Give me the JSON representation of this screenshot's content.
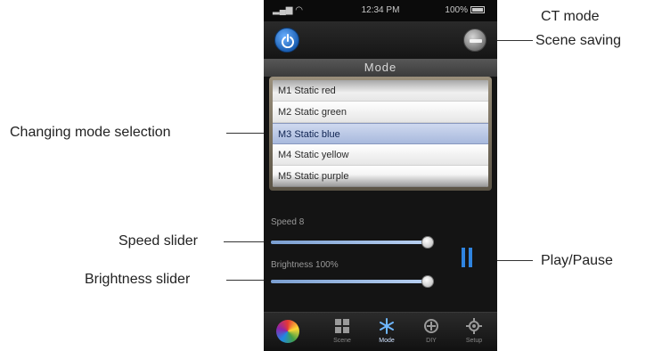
{
  "callouts": {
    "ct_mode": "CT mode",
    "scene_saving": "Scene saving",
    "changing_mode": "Changing mode selection",
    "speed_slider": "Speed slider",
    "play_pause": "Play/Pause",
    "brightness_slider": "Brightness slider"
  },
  "status_bar": {
    "time": "12:34 PM",
    "battery": "100%"
  },
  "mode_header": "Mode",
  "mode_list": [
    "M1 Static red",
    "M2 Static green",
    "M3 Static blue",
    "M4 Static yellow",
    "M5 Static purple"
  ],
  "selected_mode_index": 2,
  "speed": {
    "label": "Speed 8",
    "level": 1.0
  },
  "brightness": {
    "label": "Brightness 100%",
    "level": 1.0
  },
  "tabs": [
    {
      "label": "Scene",
      "icon": "grid-icon"
    },
    {
      "label": "Mode",
      "icon": "snowflake-icon"
    },
    {
      "label": "DIY",
      "icon": "diy-icon"
    },
    {
      "label": "Setup",
      "icon": "gear-icon"
    }
  ],
  "colors": {
    "accent": "#2f84e0",
    "selection": "#a8b9dd"
  }
}
